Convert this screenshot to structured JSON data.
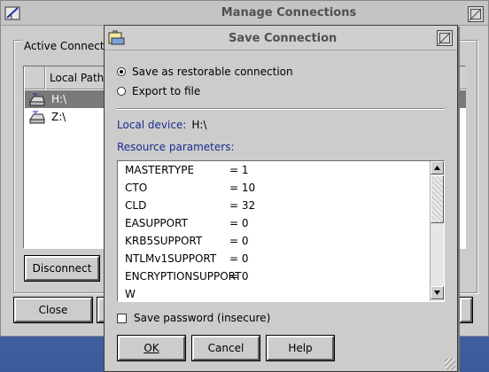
{
  "manage_window": {
    "title": "Manage Connections",
    "group_label": "Active Connections",
    "columns": [
      "Local Path"
    ],
    "rows": [
      {
        "path": "H:\\",
        "selected": true
      },
      {
        "path": "Z:\\",
        "selected": false
      }
    ],
    "disconnect_label": "Disconnect",
    "close_label": "Close"
  },
  "dialog": {
    "title": "Save Connection",
    "option_restorable": "Save as restorable connection",
    "option_export": "Export to file",
    "selected_option": "restorable",
    "local_device_label": "Local device:",
    "local_device_value": "H:\\",
    "resource_label": "Resource parameters:",
    "params": [
      {
        "name": "MASTERTYPE",
        "value": "= 1"
      },
      {
        "name": "CTO",
        "value": "= 10"
      },
      {
        "name": "CLD",
        "value": "= 32"
      },
      {
        "name": "EASUPPORT",
        "value": "= 0"
      },
      {
        "name": "KRB5SUPPORT",
        "value": "= 0"
      },
      {
        "name": "NTLMv1SUPPORT",
        "value": "= 0"
      },
      {
        "name": "ENCRYPTIONSUPPORT",
        "value": "= 0"
      },
      {
        "name": "W",
        "value": ""
      }
    ],
    "save_password_label": "Save password (insecure)",
    "save_password_checked": false,
    "ok_label": "OK",
    "cancel_label": "Cancel",
    "help_label": "Help"
  },
  "colors": {
    "window_bg": "#cccccc",
    "selection": "#7a7a7a",
    "label_blue": "#1c2c8c",
    "desktop": "#4e6fb0"
  }
}
